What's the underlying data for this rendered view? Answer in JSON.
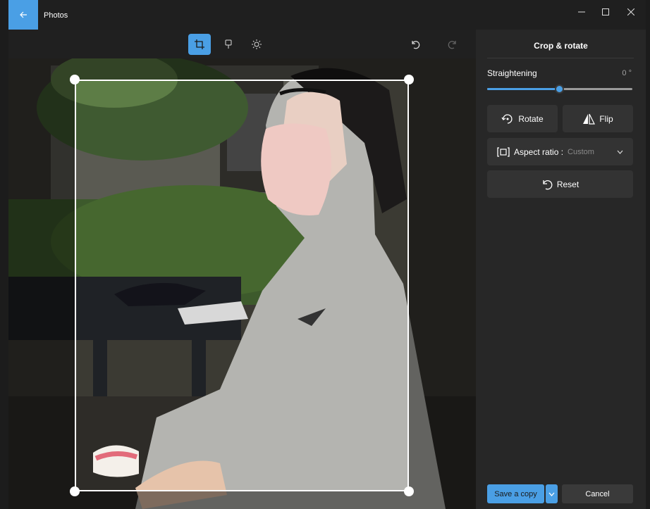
{
  "app": {
    "title": "Photos"
  },
  "toolbar": {
    "icons": [
      "crop-icon",
      "markup-icon",
      "adjustments-icon",
      "undo-icon",
      "redo-icon"
    ]
  },
  "panel": {
    "title": "Crop & rotate",
    "straightening": {
      "label": "Straightening",
      "value": "0 °",
      "level": 0.5
    },
    "rotate_label": "Rotate",
    "flip_label": "Flip",
    "aspect_ratio": {
      "label": "Aspect ratio :",
      "value": "Custom"
    },
    "reset_label": "Reset",
    "save_label": "Save a copy",
    "cancel_label": "Cancel"
  },
  "colors": {
    "accent": "#4a9fe5",
    "panel": "#272727",
    "button": "#333333"
  }
}
